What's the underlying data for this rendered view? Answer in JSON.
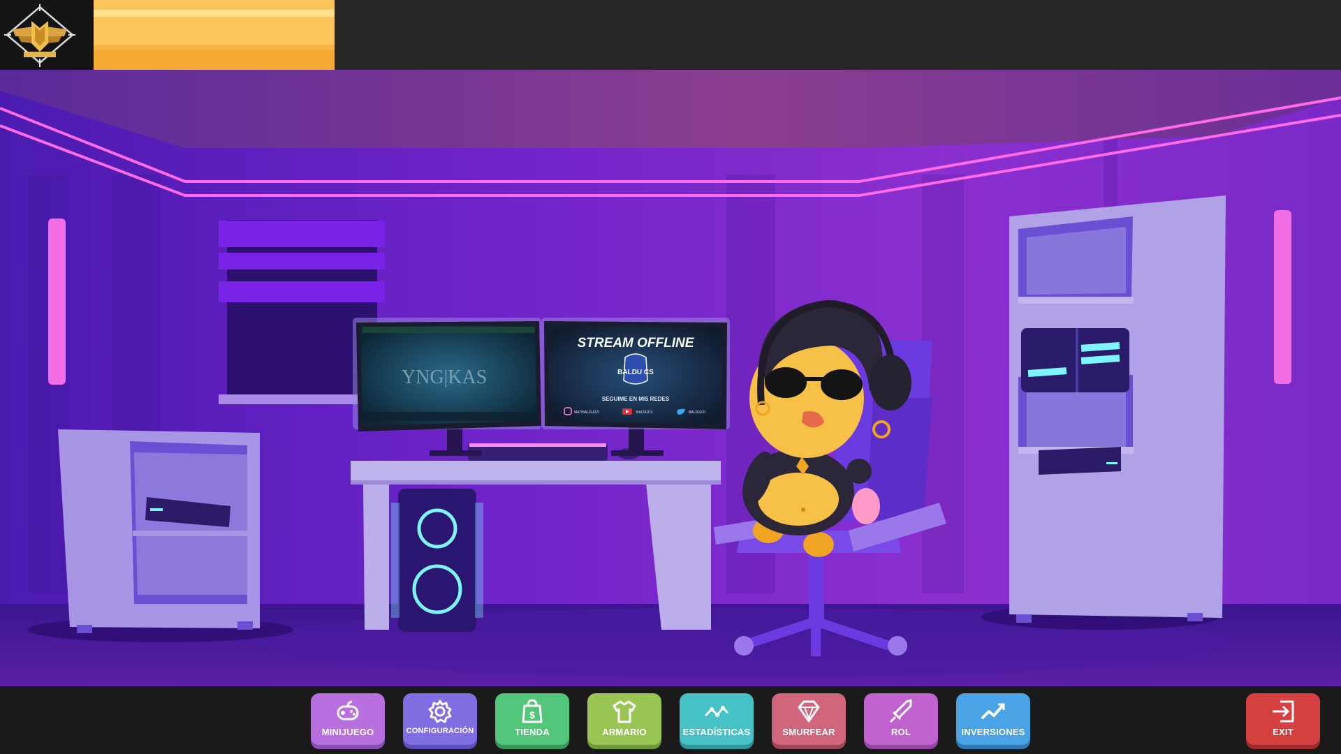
{
  "topbar": {
    "rank_icon": "gold-wing-rank-emblem-icon",
    "xp_progress": 1.0,
    "xp_color": "#fdc65c"
  },
  "scene": {
    "monitor_left": {
      "screen_text": "YNG|KAS"
    },
    "monitor_right": {
      "headline": "STREAM OFFLINE",
      "logo_text": "BALDU CS",
      "follow_text": "SEGUIME EN MIS REDES",
      "socials": [
        {
          "icon": "instagram-icon",
          "handle": "MATIBALDUZZI"
        },
        {
          "icon": "youtube-icon",
          "handle": "BALDUCS"
        },
        {
          "icon": "twitter-icon",
          "handle": "BALDUZZI"
        }
      ]
    }
  },
  "menu": {
    "buttons": [
      {
        "id": "minijuego",
        "label": "MINIJUEGO",
        "icon": "gamepad-icon",
        "color": "#b86fe0",
        "shadow": "#8a4db4"
      },
      {
        "id": "configuracion",
        "label": "CONFIGURACIÓN",
        "icon": "gear-icon",
        "color": "#7f6fe3",
        "shadow": "#5b4dbb"
      },
      {
        "id": "tienda",
        "label": "TIENDA",
        "icon": "shopping-bag-icon",
        "color": "#52c67a",
        "shadow": "#36995a"
      },
      {
        "id": "armario",
        "label": "ARMARIO",
        "icon": "tshirt-icon",
        "color": "#98c553",
        "shadow": "#709a36"
      },
      {
        "id": "estadisticas",
        "label": "ESTADÍSTICAS",
        "icon": "stats-line-icon",
        "color": "#47c3c8",
        "shadow": "#2f969c"
      },
      {
        "id": "smurfear",
        "label": "SMURFEAR",
        "icon": "diamond-icon",
        "color": "#d0657c",
        "shadow": "#a14659"
      },
      {
        "id": "rol",
        "label": "ROL",
        "icon": "sword-icon",
        "color": "#c163cf",
        "shadow": "#9444a2"
      },
      {
        "id": "inversiones",
        "label": "INVERSIONES",
        "icon": "trend-chart-icon",
        "color": "#4aa3e4",
        "shadow": "#2f78b4"
      }
    ],
    "exit": {
      "label": "EXIT",
      "icon": "exit-door-icon",
      "color": "#d54040",
      "shadow": "#9e2a2a"
    }
  }
}
